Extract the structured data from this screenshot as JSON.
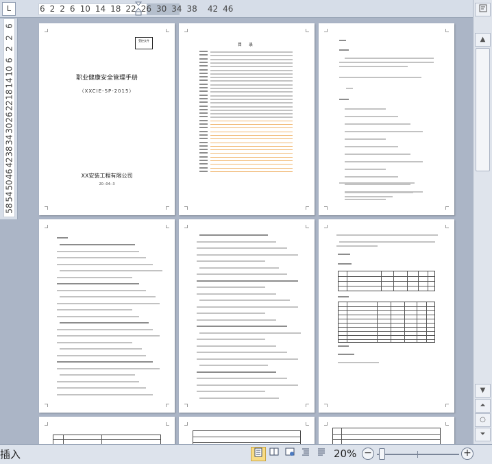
{
  "ruler": {
    "tab_selector": "L",
    "h_numbers": [
      "6",
      "2",
      "2",
      "6",
      "10",
      "14",
      "18",
      "22",
      "26",
      "30",
      "34",
      "38",
      "42",
      "46"
    ],
    "v_numbers": [
      "6",
      "2",
      "2",
      "6",
      "10",
      "14",
      "18",
      "22",
      "26",
      "30",
      "34",
      "38",
      "42",
      "46",
      "50",
      "54",
      "58"
    ]
  },
  "pages": {
    "cover": {
      "stamp": "受控文件",
      "title": "职业健康安全管理手册",
      "code": "（XXCIE-SP-2015）",
      "company": "XX安装工程有限公司",
      "date": "20--04--3"
    },
    "toc": {
      "title": "目 录"
    }
  },
  "statusbar": {
    "mode": "插入",
    "zoom_percent": "20%",
    "zoom_level": 0.2,
    "zoom_out": "−",
    "zoom_in": "+"
  },
  "icons": {
    "view_print": "print-layout-icon",
    "view_reading": "full-screen-reading-icon",
    "view_web": "web-layout-icon",
    "view_outline": "outline-icon",
    "view_draft": "draft-icon",
    "ruler_toggle": "ruler-icon",
    "scroll_up": "arrow-up-icon",
    "scroll_down": "arrow-down-icon",
    "prev_page": "double-up-icon",
    "browse_object": "browse-object-icon",
    "next_page": "double-down-icon"
  }
}
